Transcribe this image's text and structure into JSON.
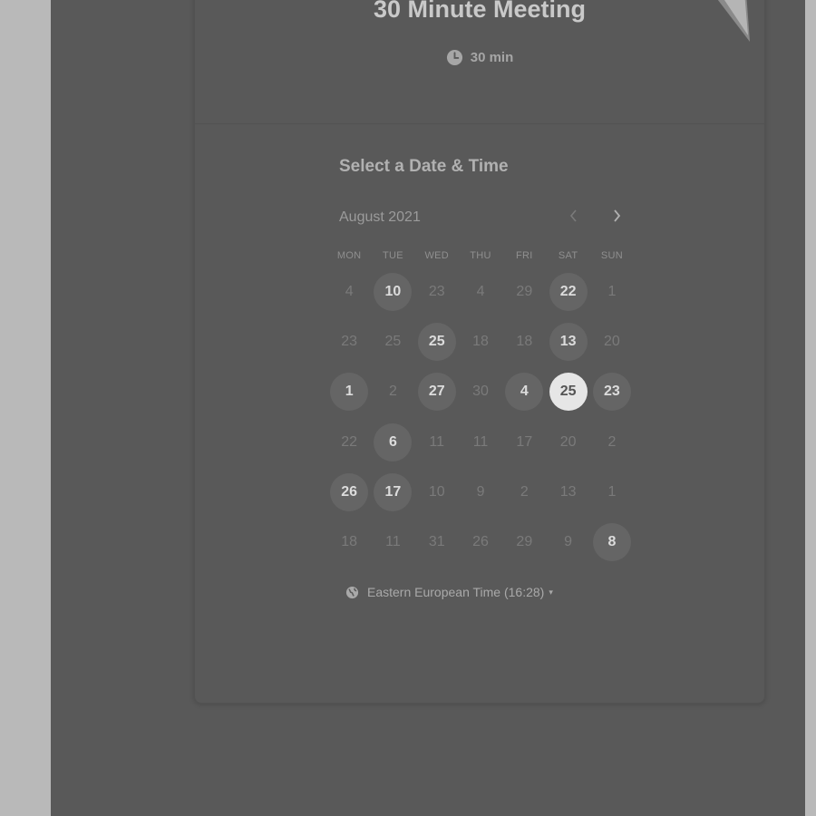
{
  "event": {
    "title": "30 Minute Meeting",
    "duration": "30 min"
  },
  "calendar": {
    "section_title": "Select a Date & Time",
    "month": "August 2021",
    "weekdays": [
      "MON",
      "TUE",
      "WED",
      "THU",
      "FRI",
      "SAT",
      "SUN"
    ],
    "rows": [
      [
        {
          "d": "4",
          "s": "n"
        },
        {
          "d": "10",
          "s": "a"
        },
        {
          "d": "23",
          "s": "n"
        },
        {
          "d": "4",
          "s": "n"
        },
        {
          "d": "29",
          "s": "n"
        },
        {
          "d": "22",
          "s": "a"
        },
        {
          "d": "1",
          "s": "n"
        }
      ],
      [
        {
          "d": "23",
          "s": "n"
        },
        {
          "d": "25",
          "s": "n"
        },
        {
          "d": "25",
          "s": "a"
        },
        {
          "d": "18",
          "s": "n"
        },
        {
          "d": "18",
          "s": "n"
        },
        {
          "d": "13",
          "s": "a"
        },
        {
          "d": "20",
          "s": "n"
        }
      ],
      [
        {
          "d": "1",
          "s": "a"
        },
        {
          "d": "2",
          "s": "n"
        },
        {
          "d": "27",
          "s": "a"
        },
        {
          "d": "30",
          "s": "n"
        },
        {
          "d": "4",
          "s": "a"
        },
        {
          "d": "25",
          "s": "s"
        },
        {
          "d": "23",
          "s": "a"
        }
      ],
      [
        {
          "d": "22",
          "s": "n"
        },
        {
          "d": "6",
          "s": "a"
        },
        {
          "d": "11",
          "s": "n"
        },
        {
          "d": "11",
          "s": "n"
        },
        {
          "d": "17",
          "s": "n"
        },
        {
          "d": "20",
          "s": "n"
        },
        {
          "d": "2",
          "s": "n"
        }
      ],
      [
        {
          "d": "26",
          "s": "a"
        },
        {
          "d": "17",
          "s": "a"
        },
        {
          "d": "10",
          "s": "n"
        },
        {
          "d": "9",
          "s": "n"
        },
        {
          "d": "2",
          "s": "n"
        },
        {
          "d": "13",
          "s": "n"
        },
        {
          "d": "1",
          "s": "n"
        }
      ],
      [
        {
          "d": "18",
          "s": "n"
        },
        {
          "d": "11",
          "s": "n"
        },
        {
          "d": "31",
          "s": "n"
        },
        {
          "d": "26",
          "s": "n"
        },
        {
          "d": "29",
          "s": "n"
        },
        {
          "d": "9",
          "s": "n"
        },
        {
          "d": "8",
          "s": "a"
        }
      ]
    ]
  },
  "timezone": {
    "label": "Eastern European Time (16:28)",
    "caret": "▾"
  },
  "icons": {
    "duration": "clock-icon",
    "timezone": "globe-icon",
    "prev": "chevron-left-icon",
    "next": "chevron-right-icon"
  },
  "colors": {
    "page_bg": "#595959",
    "side_bg": "#b9b9b9",
    "selected_day_bg": "#e6e6e6",
    "available_day_bg": "#656565"
  }
}
